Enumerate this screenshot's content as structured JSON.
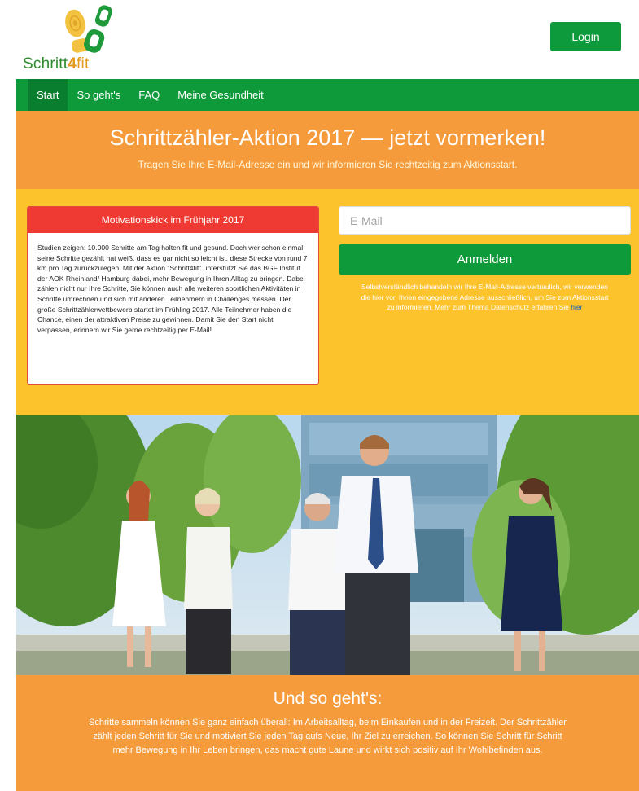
{
  "header": {
    "logo_text_part1": "Schri",
    "logo_text_tt": "tt",
    "logo_text_4": "4",
    "logo_text_fit": "fit",
    "login_label": "Login"
  },
  "nav": {
    "items": [
      {
        "label": "Start"
      },
      {
        "label": "So geht's"
      },
      {
        "label": "FAQ"
      },
      {
        "label": "Meine Gesundheit"
      }
    ]
  },
  "hero": {
    "title": "Schrittzähler-Aktion 2017 — jetzt vormerken!",
    "subtitle": "Tragen Sie Ihre E-Mail-Adresse ein und wir informieren Sie rechtzeitig zum Aktionsstart."
  },
  "panel": {
    "title": "Motivationskick im Frühjahr 2017",
    "body": "Studien zeigen: 10.000 Schritte am Tag halten fit und gesund. Doch wer schon einmal seine Schritte gezählt hat weiß, dass es gar nicht so leicht ist, diese Strecke von rund 7 km pro Tag zurückzulegen. Mit der Aktion \"Schritt4fit\" unterstützt Sie das BGF Institut der AOK Rheinland/ Hamburg dabei, mehr Bewegung in Ihren Alltag zu bringen. Dabei zählen nicht nur Ihre Schritte, Sie können auch alle weiteren sportlichen Aktivitäten in Schritte umrechnen und sich mit anderen Teilnehmern in Challenges messen. Der große Schrittzählerwettbewerb startet im Frühling 2017. Alle Teilnehmer haben die Chance, einen der attraktiven Preise zu gewinnen. Damit Sie den Start nicht verpassen, erinnern wir Sie gerne rechtzeitig per E-Mail!"
  },
  "signup": {
    "email_placeholder": "E-Mail",
    "email_value": "",
    "button_label": "Anmelden",
    "privacy_text": "Selbstverständlich behandeln wir Ihre E-Mail-Adresse vertraulich, wir verwenden die hier von Ihnen eingegebene Adresse ausschließlich, um Sie zum Aktionsstart zu informieren. Mehr zum Thema Datenschutz erfahren Sie ",
    "privacy_link": "hier"
  },
  "how": {
    "title": "Und so geht's:",
    "text": "Schritte sammeln können Sie ganz einfach überall: Im Arbeitsalltag, beim Einkaufen und in der Freizeit. Der Schrittzähler zählt jeden Schritt für Sie und motiviert Sie jeden Tag aufs Neue, Ihr Ziel zu erreichen. So können Sie Schritt für Schritt mehr Bewegung in Ihr Leben bringen, das macht gute Laune und wirkt sich positiv auf Ihr Wohlbefinden aus."
  },
  "colors": {
    "brand_green": "#0e9a3a",
    "hero_orange": "#f59b3b",
    "section_yellow": "#fcc32c",
    "panel_red": "#ee3a33"
  }
}
